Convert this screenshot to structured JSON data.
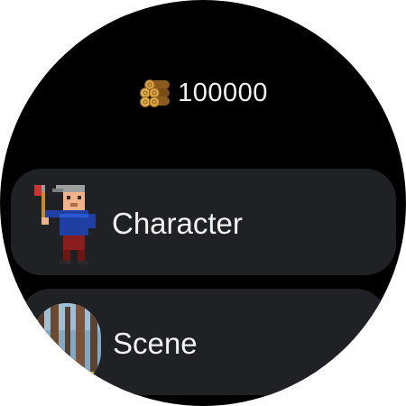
{
  "header": {
    "currency_icon": "wood-logs-icon",
    "currency_value": "100000"
  },
  "menu": {
    "items": [
      {
        "label": "Character",
        "icon": "lumberjack-character-icon"
      },
      {
        "label": "Scene",
        "icon": "forest-scene-thumbnail"
      }
    ]
  },
  "colors": {
    "background": "#000000",
    "card": "#202124",
    "text": "#f2f2f2"
  }
}
